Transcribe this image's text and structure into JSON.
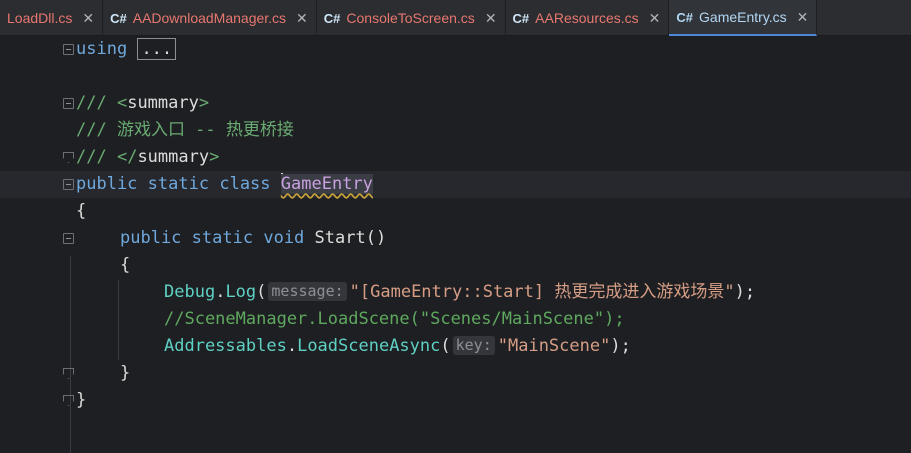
{
  "tabs": [
    {
      "prefix": "",
      "name": "LoadDll.cs",
      "close": "✕",
      "active": false,
      "color": "#e8776f"
    },
    {
      "prefix": "C#",
      "name": "AADownloadManager.cs",
      "close": "✕",
      "active": false,
      "color": "#e8776f"
    },
    {
      "prefix": "C#",
      "name": "ConsoleToScreen.cs",
      "close": "✕",
      "active": false,
      "color": "#e8776f"
    },
    {
      "prefix": "C#",
      "name": "AAResources.cs",
      "close": "✕",
      "active": false,
      "color": "#e8776f"
    },
    {
      "prefix": "C#",
      "name": "GameEntry.cs",
      "close": "✕",
      "active": true,
      "color": "#b2d7f4"
    }
  ],
  "code": {
    "using_kw": "using",
    "using_collapsed": "...",
    "doc_open_prefix": "/// ",
    "doc_open_tag_lt": "<",
    "doc_open_tag_name": "summary",
    "doc_open_tag_gt": ">",
    "doc_text": "/// 游戏入口 -- 热更桥接",
    "doc_close_prefix": "/// ",
    "doc_close_tag_lt": "</",
    "doc_close_tag_name": "summary",
    "doc_close_tag_gt": ">",
    "class_kw_public": "public",
    "class_kw_static": "static",
    "class_kw_class": "class",
    "class_name": "GameEntry",
    "brace_open": "{",
    "method_kw_public": "public",
    "method_kw_static": "static",
    "method_kw_void": "void",
    "method_name": "Start",
    "method_parens": "()",
    "method_brace_open": "{",
    "debug_type": "Debug",
    "debug_dot": ".",
    "debug_method": "Log",
    "debug_paren": "(",
    "debug_hint": "message:",
    "debug_string": "\"[GameEntry::Start] 热更完成进入游戏场景\"",
    "debug_end": ");",
    "comment_line": "//SceneManager.LoadScene(\"Scenes/MainScene\");",
    "addr_type": "Addressables",
    "addr_dot": ".",
    "addr_method": "LoadSceneAsync",
    "addr_paren": "(",
    "addr_hint": "key:",
    "addr_string": "\"MainScene\"",
    "addr_end": ");",
    "method_brace_close": "}",
    "brace_close": "}"
  }
}
